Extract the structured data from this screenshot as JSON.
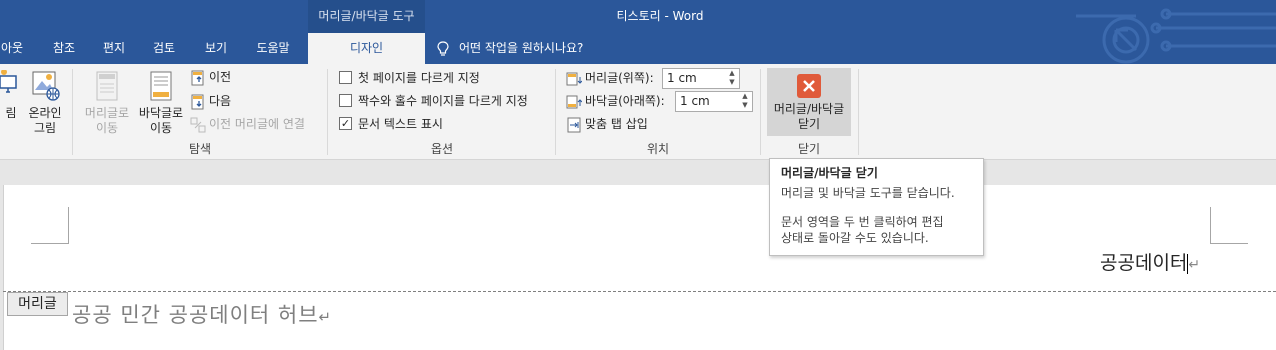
{
  "window": {
    "title": "티스토리  -  Word",
    "context_tab_group": "머리글/바닥글 도구"
  },
  "tabs": [
    {
      "label": "아웃"
    },
    {
      "label": "참조"
    },
    {
      "label": "편지"
    },
    {
      "label": "검토"
    },
    {
      "label": "보기"
    },
    {
      "label": "도움말"
    },
    {
      "label": "디자인",
      "active": true
    }
  ],
  "tell_me": {
    "label": "어떤 작업을 원하시나요?",
    "icon": "lightbulb-icon"
  },
  "ribbon": {
    "insert_partial": {
      "picture_label": "림",
      "online_picture_line1": "온라인",
      "online_picture_line2": "그림"
    },
    "navigation": {
      "goto_header_line1": "머리글로",
      "goto_header_line2": "이동",
      "goto_footer_line1": "바닥글로",
      "goto_footer_line2": "이동",
      "previous": "이전",
      "next": "다음",
      "link_previous": "이전 머리글에 연결",
      "group_label": "탐색"
    },
    "options": {
      "different_first_page": {
        "label": "첫 페이지를 다르게 지정",
        "checked": false
      },
      "different_odd_even": {
        "label": "짝수와 홀수 페이지를 다르게 지정",
        "checked": false
      },
      "show_document_text": {
        "label": "문서 텍스트 표시",
        "checked": true
      },
      "group_label": "옵션"
    },
    "position": {
      "header_from_top_label": "머리글(위쪽):",
      "header_from_top_value": "1 cm",
      "footer_from_bottom_label": "바닥글(아래쪽):",
      "footer_from_bottom_value": "1 cm",
      "insert_alignment_tab": "맞춤 탭 삽입",
      "group_label": "위치"
    },
    "close": {
      "button_line1": "머리글/바닥글",
      "button_line2": "닫기",
      "group_label": "닫기",
      "icon_color": "#e05a3a"
    }
  },
  "tooltip": {
    "title": "머리글/바닥글 닫기",
    "line1": "머리글 및 바닥글 도구를 닫습니다.",
    "line2": "문서 영역을 두 번 클릭하여 편집",
    "line3": "상태로 돌아갈 수도 있습니다."
  },
  "document": {
    "header_text": "공공데이터",
    "header_tag": "머리글",
    "body_text": "공공 민간 공공데이터 허브",
    "paragraph_mark": "↵"
  },
  "colors": {
    "title_bar": "#2b579a",
    "ribbon": "#f3f3f3"
  }
}
